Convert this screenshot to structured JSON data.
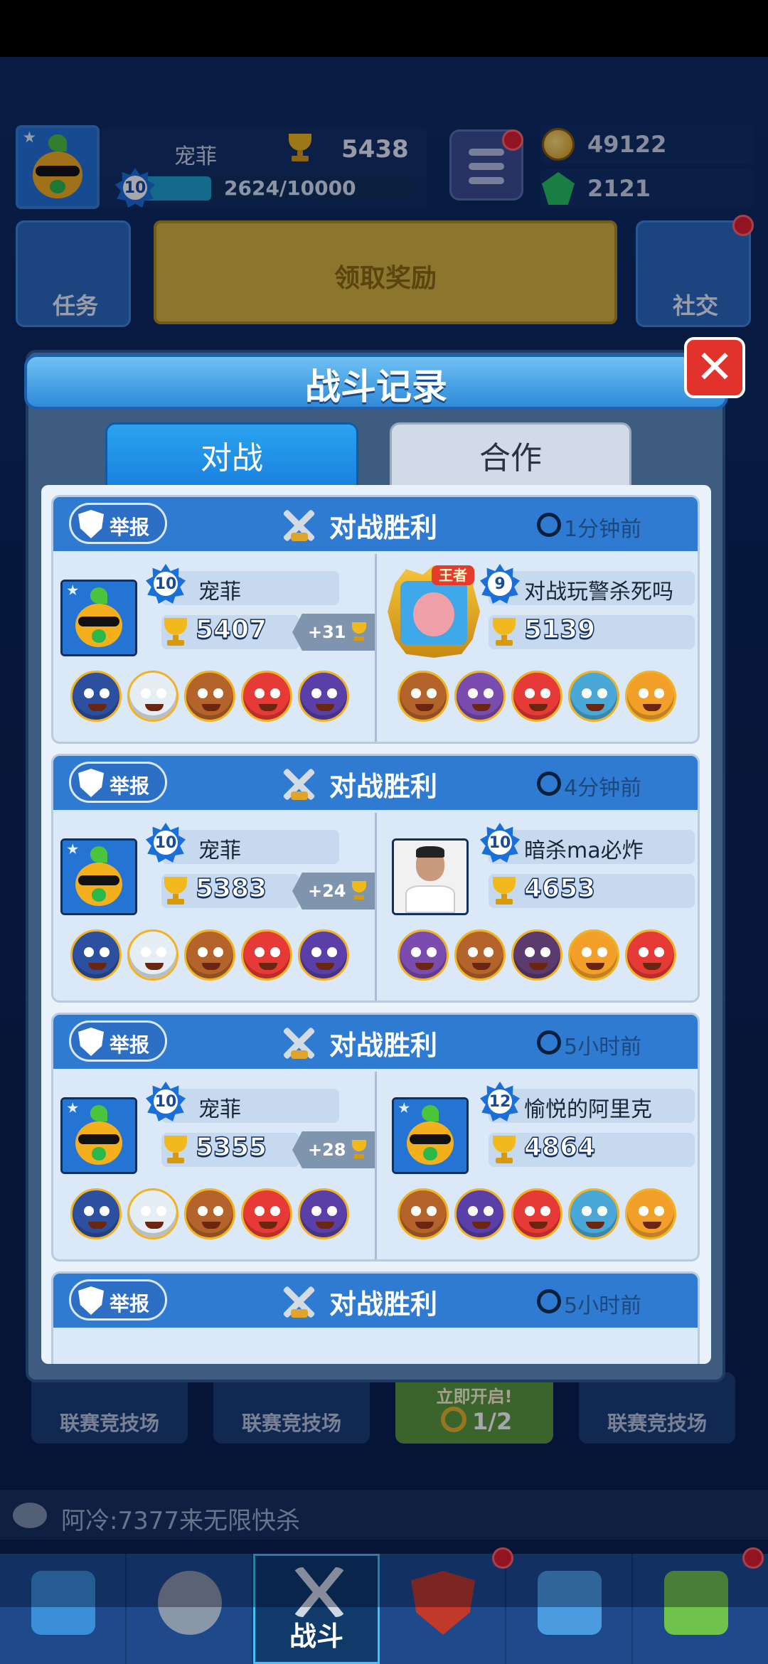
{
  "hud": {
    "player_name": "宠菲",
    "level": "10",
    "trophies": "5438",
    "exp": "2624/10000",
    "exp_fraction": 0.2624,
    "coins": "49122",
    "gems": "2121"
  },
  "buttons": {
    "tasks": "任务",
    "claim_reward": "领取奖励",
    "social": "社交"
  },
  "modal": {
    "title": "战斗记录",
    "close": "✕",
    "tabs": [
      "对战",
      "合作"
    ]
  },
  "records": [
    {
      "report": "举报",
      "result": "对战胜利",
      "time": "1分钟前",
      "left": {
        "level": "10",
        "name": "宠菲",
        "trophies": "5407",
        "gain": "+31",
        "heroes": [
          "police",
          "ghost",
          "chef",
          "clown",
          "ninja"
        ]
      },
      "right": {
        "level": "9",
        "name": "对战玩警杀死吗",
        "trophies": "5139",
        "badge": "王者",
        "heroes": [
          "chef",
          "goblin",
          "clown",
          "miner",
          "fire"
        ]
      }
    },
    {
      "report": "举报",
      "result": "对战胜利",
      "time": "4分钟前",
      "left": {
        "level": "10",
        "name": "宠菲",
        "trophies": "5383",
        "gain": "+24",
        "heroes": [
          "police",
          "ghost",
          "chef",
          "clown",
          "ninja"
        ]
      },
      "right": {
        "level": "10",
        "name": "暗杀ma必炸",
        "trophies": "4653",
        "heroes": [
          "goblin",
          "chef",
          "dark",
          "fire",
          "clown"
        ]
      }
    },
    {
      "report": "举报",
      "result": "对战胜利",
      "time": "5小时前",
      "left": {
        "level": "10",
        "name": "宠菲",
        "trophies": "5355",
        "gain": "+28",
        "heroes": [
          "police",
          "ghost",
          "chef",
          "clown",
          "ninja"
        ]
      },
      "right": {
        "level": "12",
        "name": "愉悦的阿里克",
        "trophies": "4864",
        "heroes": [
          "chef",
          "ninja",
          "clown",
          "miner",
          "fire"
        ]
      }
    },
    {
      "report": "举报",
      "result": "对战胜利",
      "time": "5小时前"
    }
  ],
  "bottom": {
    "arena_labels": [
      "联赛竞技场",
      "联赛竞技场",
      "联赛竞技场"
    ],
    "open_now": "立即开启!",
    "keys": "1/2",
    "chat": "阿冷:7377来无限快杀",
    "nav_active": "战斗"
  },
  "colors": {
    "police": "#2d4fa0",
    "ghost": "#e6eef5",
    "chef": "#b4642a",
    "clown": "#e63a36",
    "ninja": "#5a3fa8",
    "goblin": "#7a4cb0",
    "miner": "#4aa8d8",
    "fire": "#f2a02a",
    "dark": "#5b3a6e"
  }
}
